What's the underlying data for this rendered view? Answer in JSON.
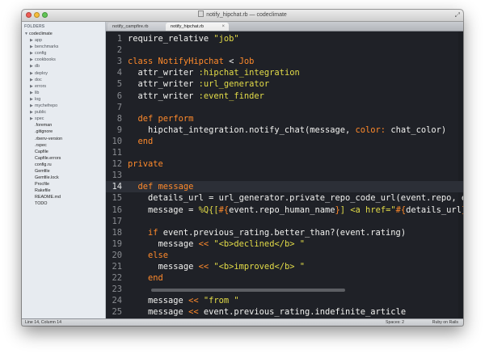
{
  "window": {
    "title": "notify_hipchat.rb — codeclimate"
  },
  "sidebar": {
    "header": "FOLDERS",
    "root": "codeclimate",
    "folders": [
      "app",
      "benchmarks",
      "config",
      "cookbooks",
      "db",
      "deploy",
      "doc",
      "errors",
      "lib",
      "log",
      "mychefrepo",
      "public",
      "spec"
    ],
    "files": [
      ".foreman",
      ".gitignore",
      ".rbenv-version",
      ".rspec",
      "Capfile",
      "Capfile.errors",
      "config.ru",
      "Gemfile",
      "Gemfile.lock",
      "Procfile",
      "Rakefile",
      "README.md",
      "TODO"
    ]
  },
  "tabs": [
    {
      "label": "notify_campfire.rb",
      "active": false
    },
    {
      "label": "notify_hipchat.rb",
      "active": true
    }
  ],
  "editor": {
    "current_line": 14,
    "lines": [
      {
        "n": "1",
        "tokens": [
          [
            "plain",
            "require_relative "
          ],
          [
            "string",
            "\"job\""
          ]
        ]
      },
      {
        "n": "2",
        "tokens": []
      },
      {
        "n": "3",
        "tokens": [
          [
            "keyword",
            "class "
          ],
          [
            "const",
            "NotifyHipchat"
          ],
          [
            "plain",
            " < "
          ],
          [
            "const",
            "Job"
          ]
        ]
      },
      {
        "n": "4",
        "tokens": [
          [
            "plain",
            "  attr_writer "
          ],
          [
            "symbol",
            ":hipchat_integration"
          ]
        ]
      },
      {
        "n": "5",
        "tokens": [
          [
            "plain",
            "  attr_writer "
          ],
          [
            "symbol",
            ":url_generator"
          ]
        ]
      },
      {
        "n": "6",
        "tokens": [
          [
            "plain",
            "  attr_writer "
          ],
          [
            "symbol",
            ":event_finder"
          ]
        ]
      },
      {
        "n": "7",
        "tokens": []
      },
      {
        "n": "8",
        "tokens": [
          [
            "keyword",
            "  def "
          ],
          [
            "method",
            "perform"
          ]
        ]
      },
      {
        "n": "9",
        "tokens": [
          [
            "plain",
            "    hipchat_integration.notify_chat(message, "
          ],
          [
            "label",
            "color:"
          ],
          [
            "plain",
            " chat_color)"
          ]
        ]
      },
      {
        "n": "10",
        "tokens": [
          [
            "keyword",
            "  end"
          ]
        ]
      },
      {
        "n": "11",
        "tokens": []
      },
      {
        "n": "12",
        "tokens": [
          [
            "keyword",
            "private"
          ]
        ]
      },
      {
        "n": "13",
        "tokens": []
      },
      {
        "n": "14",
        "tokens": [
          [
            "keyword",
            "  def "
          ],
          [
            "method",
            "message"
          ]
        ]
      },
      {
        "n": "15",
        "tokens": [
          [
            "plain",
            "    details_url = url_generator.private_repo_code_url(event.repo, event"
          ]
        ]
      },
      {
        "n": "16",
        "tokens": [
          [
            "plain",
            "    message = "
          ],
          [
            "string",
            "%Q{["
          ],
          [
            "interp",
            "#{"
          ],
          [
            "plain",
            "event.repo_human_name"
          ],
          [
            "interp",
            "}"
          ],
          [
            "string",
            "] <a href=\""
          ],
          [
            "interp",
            "#{"
          ],
          [
            "plain",
            "details_url"
          ],
          [
            "interp",
            "}"
          ],
          [
            "string",
            "\"><"
          ]
        ]
      },
      {
        "n": "17",
        "tokens": []
      },
      {
        "n": "18",
        "tokens": [
          [
            "keyword",
            "    if "
          ],
          [
            "plain",
            "event.previous_rating.better_than?(event.rating)"
          ]
        ]
      },
      {
        "n": "19",
        "tokens": [
          [
            "plain",
            "      message "
          ],
          [
            "op",
            "<<"
          ],
          [
            "plain",
            " "
          ],
          [
            "string",
            "\"<b>declined</b> \""
          ]
        ]
      },
      {
        "n": "20",
        "tokens": [
          [
            "keyword",
            "    else"
          ]
        ]
      },
      {
        "n": "21",
        "tokens": [
          [
            "plain",
            "      message "
          ],
          [
            "op",
            "<<"
          ],
          [
            "plain",
            " "
          ],
          [
            "string",
            "\"<b>improved</b> \""
          ]
        ]
      },
      {
        "n": "22",
        "tokens": [
          [
            "keyword",
            "    end"
          ]
        ]
      },
      {
        "n": "23",
        "tokens": []
      },
      {
        "n": "24",
        "tokens": [
          [
            "plain",
            "    message "
          ],
          [
            "op",
            "<<"
          ],
          [
            "plain",
            " "
          ],
          [
            "string",
            "\"from \""
          ]
        ]
      },
      {
        "n": "25",
        "tokens": [
          [
            "plain",
            "    message "
          ],
          [
            "op",
            "<<"
          ],
          [
            "plain",
            " event.previous_rating.indefinite_article"
          ]
        ]
      }
    ]
  },
  "status": {
    "position": "Line 14, Column 14",
    "spaces": "Spaces: 2",
    "syntax": "Ruby on Rails"
  },
  "icons": {
    "close": "close-dot",
    "minimize": "minimize-dot",
    "maximize": "maximize-dot",
    "fullscreen": "fullscreen-arrows",
    "file": "document-icon",
    "folder_arrow": "disclosure-triangle",
    "tab_close": "close-x"
  },
  "colors": {
    "editor_bg": "#1f2127",
    "keyword": "#ff8a2b",
    "string": "#e3dc48",
    "text": "#f2f2f0"
  }
}
